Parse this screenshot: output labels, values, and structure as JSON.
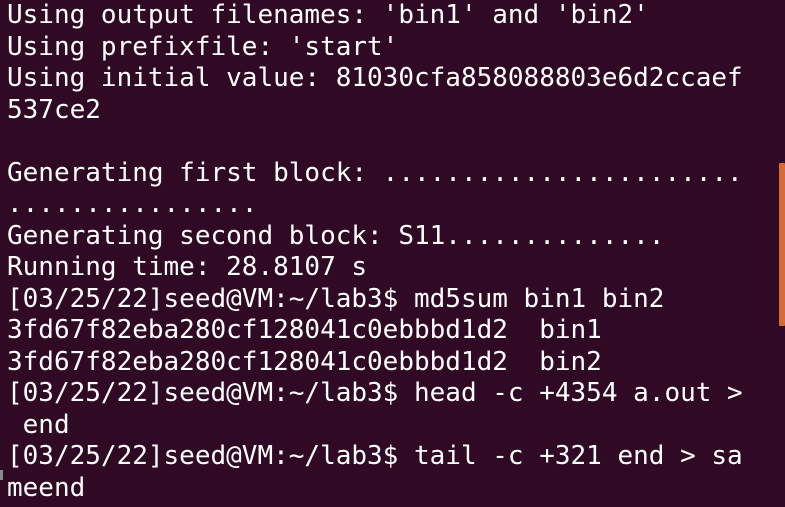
{
  "terminal": {
    "lines": [
      "Using output filenames: 'bin1' and 'bin2'",
      "Using prefixfile: 'start'",
      "Using initial value: 81030cfa858088803e6d2ccaef",
      "537ce2",
      "",
      "Generating first block: .......................",
      "................",
      "Generating second block: S11..............",
      "Running time: 28.8107 s",
      "[03/25/22]seed@VM:~/lab3$ md5sum bin1 bin2",
      "3fd67f82eba280cf128041c0ebbbd1d2  bin1",
      "3fd67f82eba280cf128041c0ebbbd1d2  bin2",
      "[03/25/22]seed@VM:~/lab3$ head -c +4354 a.out >",
      " end",
      "[03/25/22]seed@VM:~/lab3$ tail -c +321 end > sa",
      "meend"
    ]
  },
  "colors": {
    "background": "#300a24",
    "foreground": "#ffffff",
    "scrollbar": "#d76a35"
  }
}
